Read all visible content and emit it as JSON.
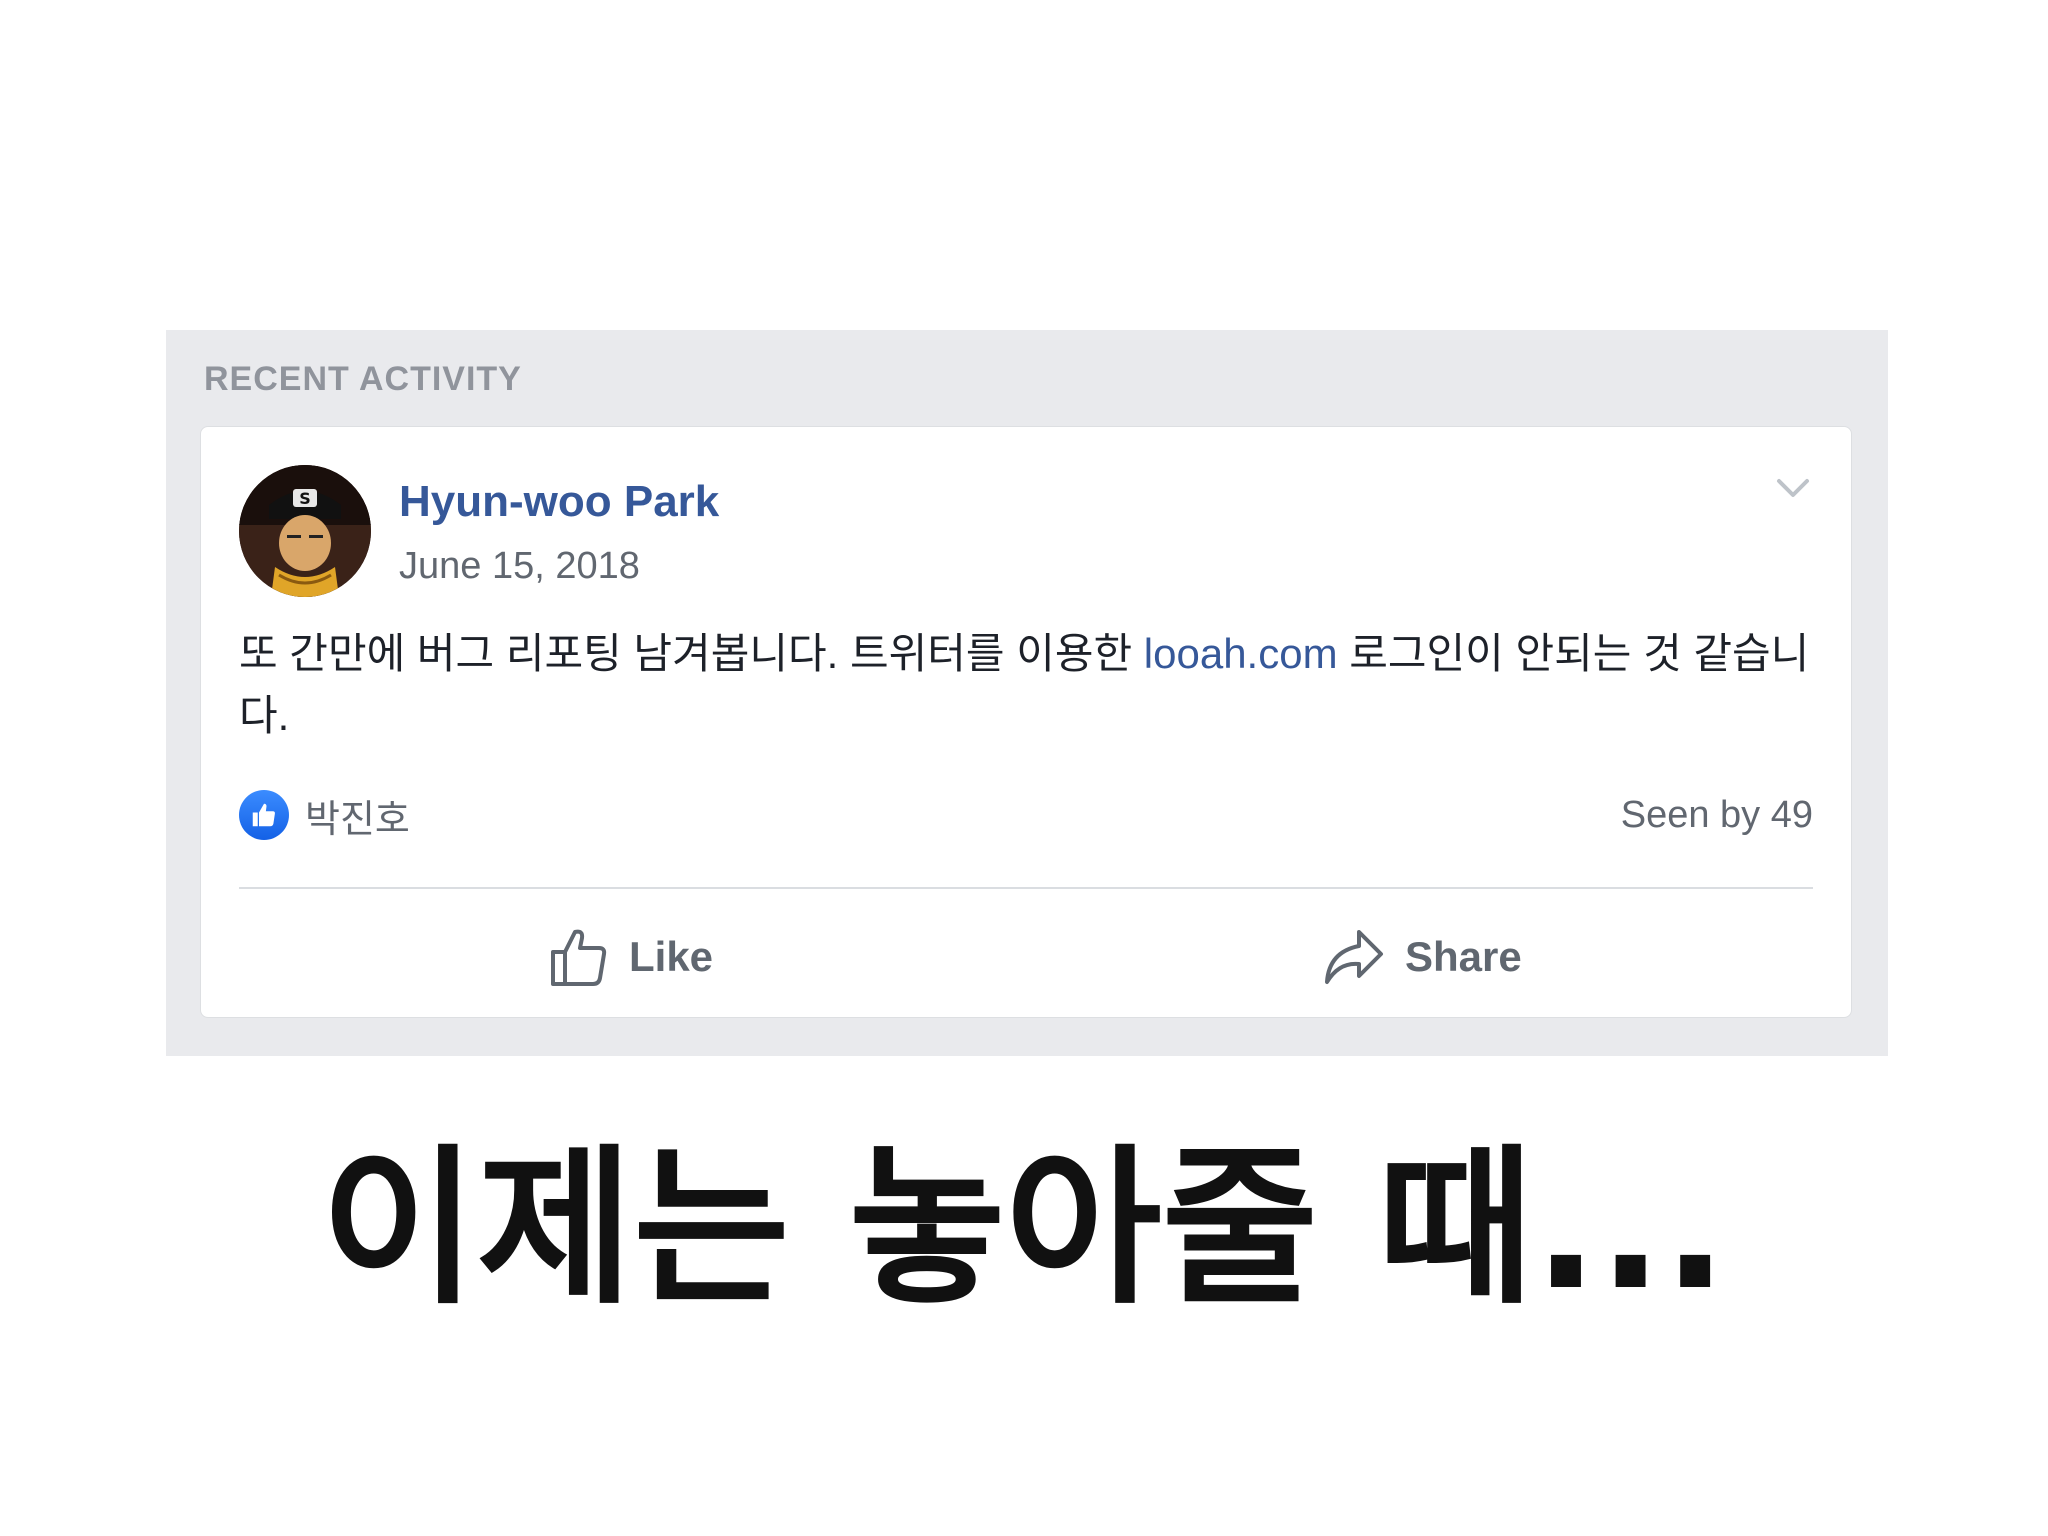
{
  "section": {
    "title": "RECENT ACTIVITY"
  },
  "post": {
    "author": "Hyun-woo Park",
    "date": "June 15, 2018",
    "text_before_link": "또 간만에 버그 리포팅 남겨봅니다. 트위터를 이용한 ",
    "link_text": "looah.com",
    "text_after_link": " 로그인이 안되는 것 같습니다.",
    "reactor_name": "박진호",
    "seen_by": "Seen by 49",
    "like_label": "Like",
    "share_label": "Share"
  },
  "caption": "이제는 놓아줄 때...",
  "icons": {
    "avatar": "avatar-image",
    "chevron": "chevron-down-icon",
    "reaction": "thumbs-up-icon",
    "like": "thumbs-up-outline-icon",
    "share": "share-arrow-icon"
  },
  "colors": {
    "link": "#365899",
    "panel_bg": "#e9eaed",
    "like_badge": "#1877f2"
  }
}
